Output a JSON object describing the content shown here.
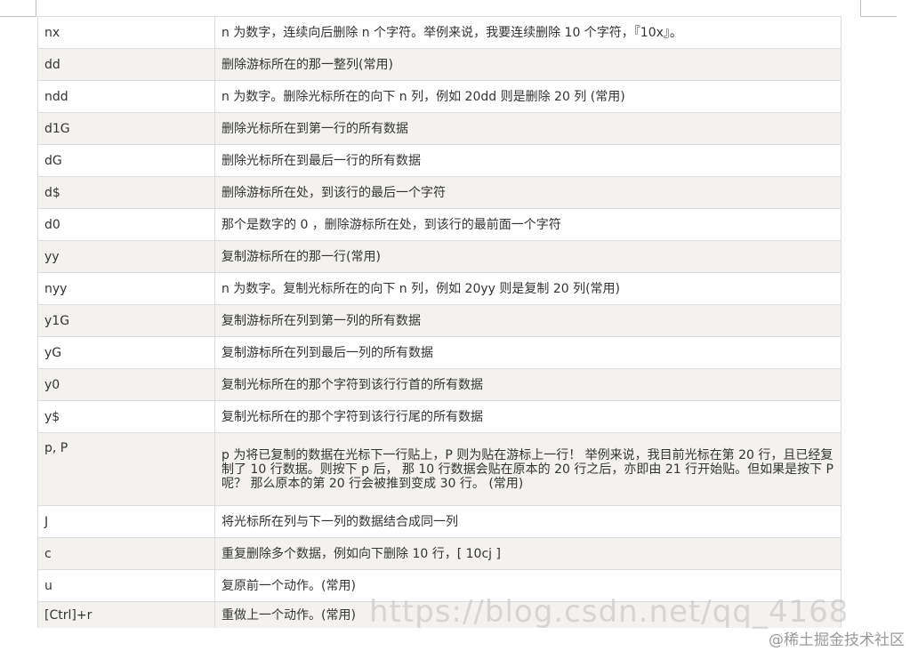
{
  "rows": [
    {
      "cmd": "nx",
      "desc": "n 为数字，连续向后删除 n 个字符。举例来说，我要连续删除 10 个字符，『10x』。"
    },
    {
      "cmd": "dd",
      "desc": "删除游标所在的那一整列(常用)"
    },
    {
      "cmd": "ndd",
      "desc": "n 为数字。删除光标所在的向下 n 列，例如 20dd 则是删除 20 列 (常用)"
    },
    {
      "cmd": "d1G",
      "desc": "删除光标所在到第一行的所有数据"
    },
    {
      "cmd": "dG",
      "desc": "删除光标所在到最后一行的所有数据"
    },
    {
      "cmd": "d$",
      "desc": "删除游标所在处，到该行的最后一个字符"
    },
    {
      "cmd": "d0",
      "desc": "那个是数字的 0 ，删除游标所在处，到该行的最前面一个字符"
    },
    {
      "cmd": "yy",
      "desc": "复制游标所在的那一行(常用)"
    },
    {
      "cmd": "nyy",
      "desc": "n 为数字。复制光标所在的向下 n 列，例如 20yy 则是复制 20 列(常用)"
    },
    {
      "cmd": "y1G",
      "desc": "复制游标所在列到第一列的所有数据"
    },
    {
      "cmd": "yG",
      "desc": "复制游标所在列到最后一列的所有数据"
    },
    {
      "cmd": "y0",
      "desc": "复制光标所在的那个字符到该行行首的所有数据"
    },
    {
      "cmd": "y$",
      "desc": "复制光标所在的那个字符到该行行尾的所有数据"
    },
    {
      "cmd": "p, P",
      "desc": "p 为将已复制的数据在光标下一行贴上，P 则为贴在游标上一行！ 举例来说，我目前光标在第 20 行，且已经复制了 10 行数据。则按下 p 后， 那 10 行数据会贴在原本的 20 行之后，亦即由 21 行开始贴。但如果是按下 P 呢？ 那么原本的第 20 行会被推到变成 30 行。 (常用)"
    },
    {
      "cmd": "J",
      "desc": "将光标所在列与下一列的数据结合成同一列"
    },
    {
      "cmd": "c",
      "desc": "重复删除多个数据，例如向下删除 10 行，[ 10cj ]"
    },
    {
      "cmd": "u",
      "desc": "复原前一个动作。(常用)"
    },
    {
      "cmd": "[Ctrl]+r",
      "desc": "重做上一个动作。(常用)"
    }
  ],
  "watermarks": {
    "url": "https://blog.csdn.net/qq_4168",
    "site": "@稀土掘金技术社区"
  }
}
